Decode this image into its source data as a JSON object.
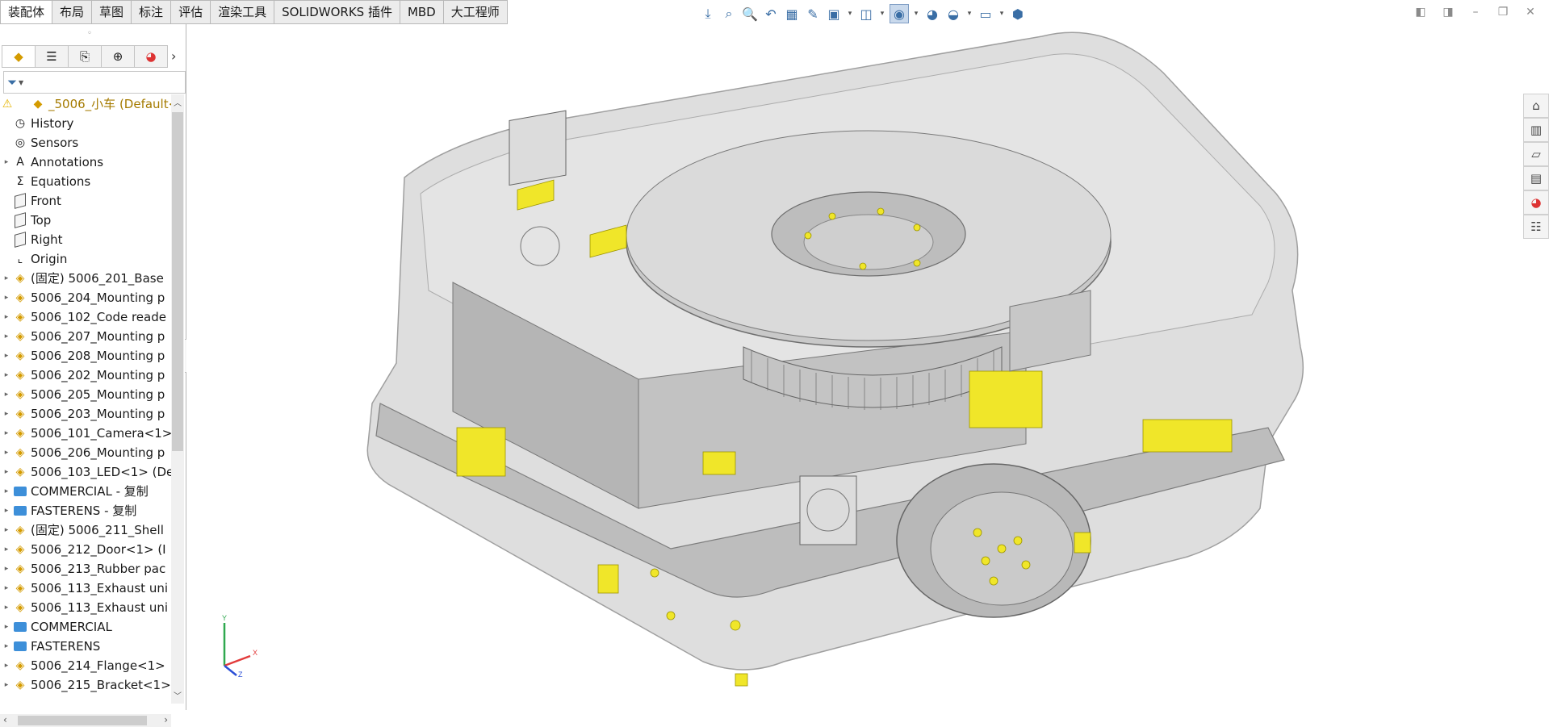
{
  "tabs": [
    "装配体",
    "布局",
    "草图",
    "标注",
    "评估",
    "渲染工具",
    "SOLIDWORKS 插件",
    "MBD",
    "大工程师"
  ],
  "active_tab": 0,
  "toolbar_icons": [
    "view-orientation-icon",
    "zoom-to-fit-icon",
    "zoom-area-icon",
    "previous-view-icon",
    "section-view-icon",
    "dynamic-annotation-icon",
    "view-settings-icon",
    "display-style-icon",
    "hide-show-icon",
    "edit-appearance-icon",
    "apply-scene-icon",
    "view-display-icon",
    "3d-view-icon"
  ],
  "window_controls": [
    "pane-left-icon",
    "pane-right-icon",
    "minimize-icon",
    "restore-icon",
    "close-icon"
  ],
  "panel_tabs": [
    "featuremanager-icon",
    "propertymanager-icon",
    "configurationmanager-icon",
    "dimxpert-icon",
    "display-manager-icon"
  ],
  "filter_symbol": "▼",
  "tree": [
    {
      "label": "_5006_小车  (Default<",
      "icon": "assembly-icon",
      "root": true
    },
    {
      "label": "History",
      "icon": "history-icon"
    },
    {
      "label": "Sensors",
      "icon": "sensors-icon"
    },
    {
      "label": "Annotations",
      "icon": "annotations-icon",
      "expand": true
    },
    {
      "label": "Equations",
      "icon": "equations-icon"
    },
    {
      "label": "Front",
      "icon": "plane-icon"
    },
    {
      "label": "Top",
      "icon": "plane-icon"
    },
    {
      "label": "Right",
      "icon": "plane-icon"
    },
    {
      "label": "Origin",
      "icon": "origin-icon"
    },
    {
      "label": "(固定) 5006_201_Base",
      "icon": "subassembly-icon",
      "expand": true
    },
    {
      "label": "5006_204_Mounting p",
      "icon": "subassembly-icon",
      "expand": true
    },
    {
      "label": "5006_102_Code reade",
      "icon": "subassembly-icon",
      "expand": true
    },
    {
      "label": "5006_207_Mounting p",
      "icon": "subassembly-icon",
      "expand": true
    },
    {
      "label": "5006_208_Mounting p",
      "icon": "subassembly-icon",
      "expand": true
    },
    {
      "label": "5006_202_Mounting p",
      "icon": "subassembly-icon",
      "expand": true
    },
    {
      "label": "5006_205_Mounting p",
      "icon": "subassembly-icon",
      "expand": true
    },
    {
      "label": "5006_203_Mounting p",
      "icon": "subassembly-icon",
      "expand": true
    },
    {
      "label": "5006_101_Camera<1>",
      "icon": "subassembly-icon",
      "expand": true
    },
    {
      "label": "5006_206_Mounting p",
      "icon": "subassembly-icon",
      "expand": true
    },
    {
      "label": "5006_103_LED<1> (De",
      "icon": "subassembly-icon",
      "expand": true
    },
    {
      "label": "COMMERCIAL - 复制",
      "icon": "folder-icon",
      "expand": true
    },
    {
      "label": "FASTERENS - 复制",
      "icon": "folder-icon",
      "expand": true
    },
    {
      "label": "(固定) 5006_211_Shell",
      "icon": "subassembly-icon",
      "expand": true
    },
    {
      "label": "5006_212_Door<1> (I",
      "icon": "subassembly-icon",
      "expand": true
    },
    {
      "label": "5006_213_Rubber pac",
      "icon": "subassembly-icon",
      "expand": true
    },
    {
      "label": "5006_113_Exhaust uni",
      "icon": "subassembly-icon",
      "expand": true
    },
    {
      "label": "5006_113_Exhaust uni",
      "icon": "subassembly-icon",
      "expand": true
    },
    {
      "label": "COMMERCIAL",
      "icon": "folder-icon",
      "expand": true
    },
    {
      "label": "FASTERENS",
      "icon": "folder-icon",
      "expand": true
    },
    {
      "label": "5006_214_Flange<1>",
      "icon": "subassembly-icon",
      "expand": true
    },
    {
      "label": "5006_215_Bracket<1>",
      "icon": "subassembly-icon",
      "expand": true
    }
  ],
  "taskpane_icons": [
    "home-icon",
    "design-library-icon",
    "file-explorer-icon",
    "view-palette-icon",
    "appearances-icon",
    "custom-properties-icon"
  ],
  "triad": {
    "x": "X",
    "y": "Y",
    "z": "Z"
  },
  "colors": {
    "model_gray": "#c8c8c8",
    "hardware_yellow": "#f0e629",
    "warning": "#f5c400",
    "folder_blue": "#3d8fd9"
  }
}
